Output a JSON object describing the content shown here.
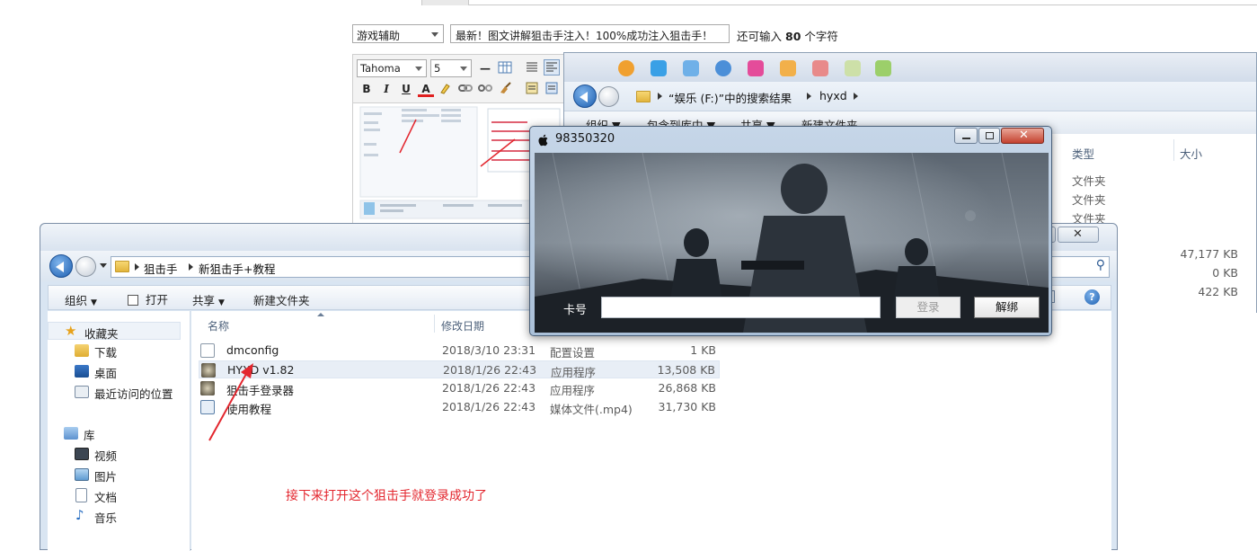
{
  "post_editor": {
    "category_value": "游戏辅助",
    "title_value": "最新！图文讲解狙击手注入！100%成功注入狙击手！",
    "char_count_prefix": "还可输入",
    "char_count_number": "80",
    "char_count_suffix": "个字符",
    "font_family_value": "Tahoma",
    "font_size_value": "5",
    "bold_label": "B",
    "italic_label": "I",
    "underline_label": "U",
    "font_color_label": "A"
  },
  "search_window": {
    "breadcrumb_drive": "“娱乐 (F:)”中的搜索结果",
    "breadcrumb_folder": "hyxd",
    "cmd_items": [
      "组织 ▼",
      "包含到库中 ▼",
      "共享 ▼",
      "新建文件夹"
    ],
    "col_type": "类型",
    "col_size": "大小",
    "types": [
      "文件夹",
      "文件夹",
      "文件夹"
    ],
    "sizes": [
      "47,177 KB",
      "0 KB",
      "422 KB"
    ]
  },
  "explorer": {
    "breadcrumb": [
      "狙击手",
      "新狙击手+教程"
    ],
    "cmd_organize": "组织",
    "cmd_open": "打开",
    "cmd_share": "共享",
    "cmd_new_folder": "新建文件夹",
    "col_name": "名称",
    "col_date": "修改日期",
    "nav": {
      "favorites": "收藏夹",
      "downloads": "下载",
      "desktop": "桌面",
      "recent": "最近访问的位置",
      "libraries": "库",
      "videos": "视频",
      "pictures": "图片",
      "documents": "文档",
      "music": "音乐"
    },
    "files": [
      {
        "name": "dmconfig",
        "date": "2018/3/10 23:31",
        "type": "配置设置",
        "size": "1 KB"
      },
      {
        "name": "HYXD v1.82",
        "date": "2018/1/26 22:43",
        "type": "应用程序",
        "size": "13,508 KB"
      },
      {
        "name": "狙击手登录器",
        "date": "2018/1/26 22:43",
        "type": "应用程序",
        "size": "26,868 KB"
      },
      {
        "name": "使用教程",
        "date": "2018/1/26 22:43",
        "type": "媒体文件(.mp4)",
        "size": "31,730 KB"
      }
    ]
  },
  "annotation": "接下来打开这个狙击手就登录成功了",
  "login_dialog": {
    "title": "98350320",
    "card_label": "卡号",
    "card_value": "",
    "login_button": "登录",
    "unbind_button": "解绑"
  },
  "colors": {
    "annotation_red": "#e3262e",
    "explorer_frame": "#d9e5f2",
    "dialog_frame": "#aac0d8"
  }
}
